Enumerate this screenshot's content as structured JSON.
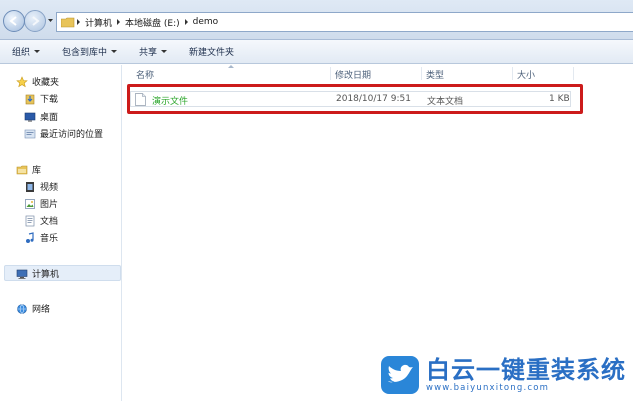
{
  "address": {
    "crumbs": [
      "计算机",
      "本地磁盘 (E:)",
      "demo"
    ]
  },
  "toolbar": {
    "organize": "组织",
    "include_library": "包含到库中",
    "share": "共享",
    "new_folder": "新建文件夹"
  },
  "sidebar": {
    "favorites": "收藏夹",
    "downloads": "下载",
    "desktop": "桌面",
    "recent": "最近访问的位置",
    "libraries": "库",
    "videos": "视频",
    "pictures": "图片",
    "documents": "文档",
    "music": "音乐",
    "computer": "计算机",
    "network": "网络"
  },
  "columns": {
    "name": "名称",
    "date": "修改日期",
    "type": "类型",
    "size": "大小"
  },
  "files": [
    {
      "name": "演示文件",
      "date": "2018/10/17 9:51",
      "type": "文本文档",
      "size": "1 KB"
    }
  ],
  "watermark": {
    "brand": "白云一键重装系统",
    "url": "www.baiyunxitong.com"
  },
  "colors": {
    "highlight": "#cc1b1b",
    "filename": "#2aa52a",
    "brand": "#2a6fc4"
  }
}
